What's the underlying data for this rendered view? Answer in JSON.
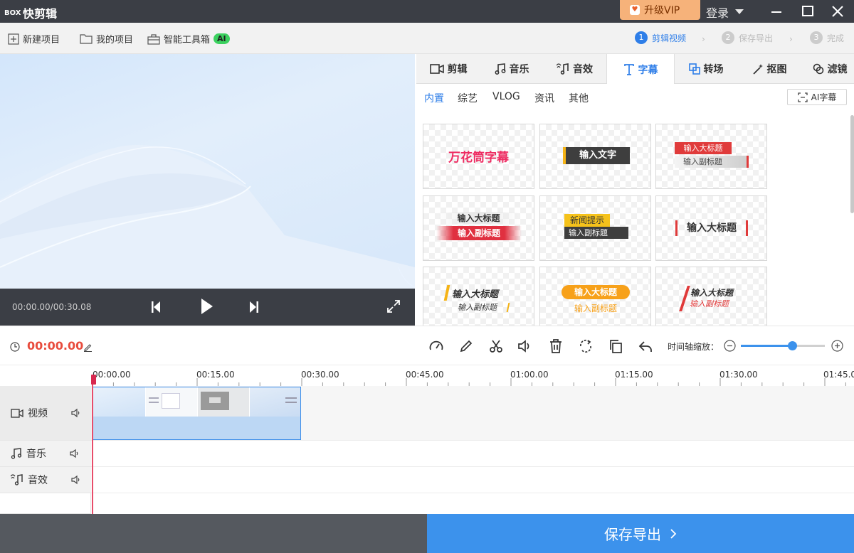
{
  "app": {
    "logo_text": "BOX",
    "title": "快剪辑"
  },
  "titlebar": {
    "vip_icon": "crown-icon",
    "vip_label": "升级VIP",
    "login_label": "登录"
  },
  "toolbar": {
    "new_project": "新建项目",
    "my_projects": "我的项目",
    "smart_toolbox": "智能工具箱",
    "ai_badge": "AI"
  },
  "steps": [
    {
      "num": "1",
      "label": "剪辑视频",
      "active": true
    },
    {
      "num": "2",
      "label": "保存导出",
      "active": false
    },
    {
      "num": "3",
      "label": "完成",
      "active": false
    }
  ],
  "player": {
    "timecode": "00:00.00/00:30.08"
  },
  "tabs": [
    {
      "label": "剪辑",
      "icon": "video-camera-icon"
    },
    {
      "label": "音乐",
      "icon": "music-note-icon"
    },
    {
      "label": "音效",
      "icon": "sound-effect-icon"
    },
    {
      "label": "字幕",
      "icon": "text-t-icon",
      "active": true
    },
    {
      "label": "转场",
      "icon": "transition-icon"
    },
    {
      "label": "抠图",
      "icon": "magic-wand-icon"
    },
    {
      "label": "滤镜",
      "icon": "filter-icon"
    }
  ],
  "subtabs": [
    "内置",
    "综艺",
    "VLOG",
    "资讯",
    "其他"
  ],
  "ai_subtitle_label": "AI字幕",
  "templates": {
    "t1": "万花筒字幕",
    "t2": "输入文字",
    "t3_title": "输入大标题",
    "t3_sub": "输入副标题",
    "t4_title": "输入大标题",
    "t4_sub": "输入副标题",
    "t5_title": "新闻提示",
    "t5_sub": "输入副标题",
    "t6": "输入大标题",
    "t7_title": "输入大标题",
    "t7_sub": "输入副标题",
    "t8_title": "输入大标题",
    "t8_sub": "输入副标题",
    "t9_title": "输入大标题",
    "t9_sub": "输入副标题"
  },
  "timeline": {
    "current_time": "00:00.00",
    "zoom_label": "时间轴缩放：",
    "zoom_level": 0.61,
    "ticks": [
      "00:00.00",
      "00:15.00",
      "00:30.00",
      "00:45.00",
      "01:00.00",
      "01:15.00",
      "01:30.00",
      "01:45.00"
    ],
    "tracks": [
      {
        "label": "视频",
        "icon": "video-camera-icon"
      },
      {
        "label": "音乐",
        "icon": "music-note-icon"
      },
      {
        "label": "音效",
        "icon": "sound-effect-icon"
      }
    ]
  },
  "footer": {
    "save_label": "保存导出"
  },
  "colors": {
    "accent": "#2e7ee8",
    "titlebar": "#3b3e45",
    "vip": "#f6b27a",
    "time_red": "#e84c3d",
    "save_button": "#3c92ec"
  }
}
